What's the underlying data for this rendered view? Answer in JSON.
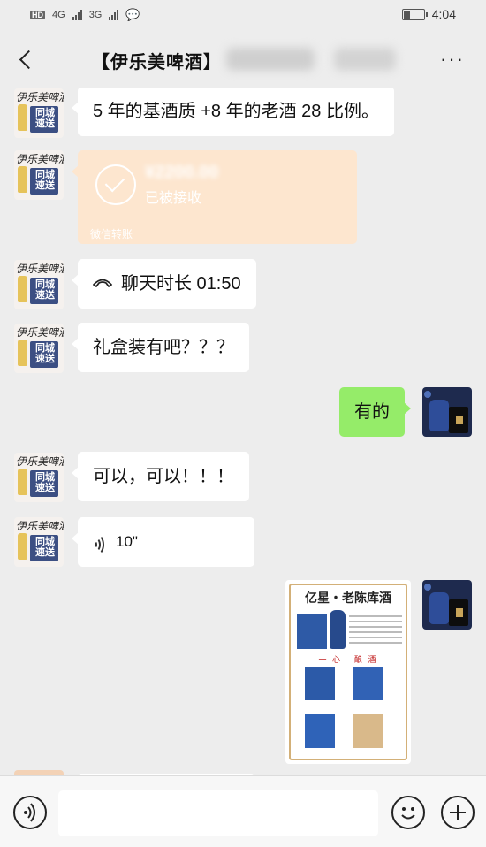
{
  "status_bar": {
    "hd": "HD",
    "network_1": "4G",
    "network_2": "3G",
    "time": "4:04"
  },
  "nav": {
    "title": "【伊乐美啤酒】",
    "more_label": "···"
  },
  "contact_avatar": {
    "text_top": "伊乐美啤酒",
    "text_box": "同城速送"
  },
  "messages": [
    {
      "side": "left",
      "type": "text",
      "text": "5 年的基酒质 +8 年的老酒 28 比例。"
    },
    {
      "side": "left",
      "type": "transfer",
      "status": "已被接收",
      "label": "微信转账"
    },
    {
      "side": "left",
      "type": "call",
      "text": "聊天时长 01:50"
    },
    {
      "side": "left",
      "type": "text",
      "text": "礼盒装有吧？？？"
    },
    {
      "side": "right",
      "type": "text",
      "text": "有的"
    },
    {
      "side": "left",
      "type": "text",
      "text": "可以，可以！！！"
    },
    {
      "side": "left",
      "type": "voice",
      "text": "10\""
    },
    {
      "side": "right",
      "type": "image",
      "caption_title": "亿星・老陈库酒",
      "red_slogan": "一 心 · 酿 酒"
    }
  ],
  "colors": {
    "background": "#ededed",
    "bubble_left": "#ffffff",
    "bubble_right": "#95ec69",
    "transfer": "#fde6cf"
  }
}
